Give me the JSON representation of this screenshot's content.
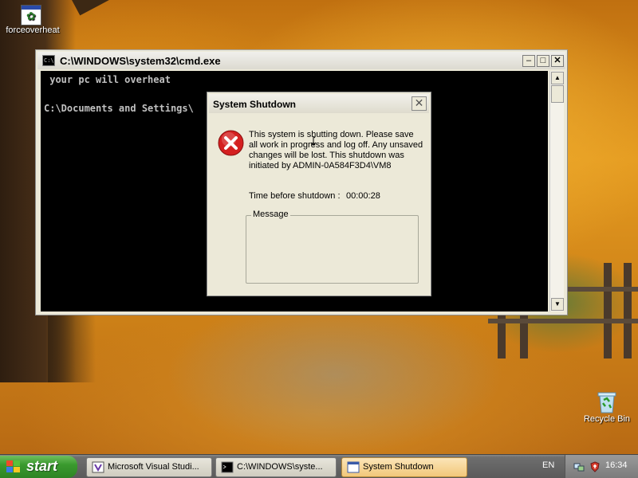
{
  "desktop": {
    "icons": [
      {
        "label": "forceoverheat",
        "icon": "program-icon"
      },
      {
        "label": "Recycle Bin",
        "icon": "recycle-bin-icon"
      }
    ]
  },
  "cmd_window": {
    "title": "C:\\WINDOWS\\system32\\cmd.exe",
    "lines": [
      " your pc will overheat",
      "",
      "C:\\Documents and Settings\\"
    ],
    "buttons": {
      "minimize": "–",
      "maximize": "□",
      "close": "✕"
    }
  },
  "shutdown_dialog": {
    "title": "System Shutdown",
    "close": "✕",
    "message": "This system is shutting down. Please save all work in progress and log off. Any unsaved changes will be lost. This shutdown was initiated by ADMIN-0A584F3D4\\VM8",
    "time_label": "Time before shutdown :",
    "time_value": "00:00:28",
    "message_group_label": "Message",
    "message_group_text": "",
    "icon": "error-icon"
  },
  "taskbar": {
    "start_label": "start",
    "tasks": [
      {
        "label": "Microsoft Visual Studi...",
        "icon": "visual-studio-icon",
        "active": false
      },
      {
        "label": "C:\\WINDOWS\\syste...",
        "icon": "cmd-icon",
        "active": false
      },
      {
        "label": "System Shutdown",
        "icon": "window-icon",
        "active": true
      }
    ],
    "language": "EN",
    "clock": "16:34"
  },
  "colors": {
    "error_red": "#d42020",
    "cmd_background": "#000000",
    "cmd_text": "#c0c0c0",
    "dialog_face": "#ece9d8",
    "start_green": "#3a9a2e",
    "active_task": "#f2c87a"
  }
}
